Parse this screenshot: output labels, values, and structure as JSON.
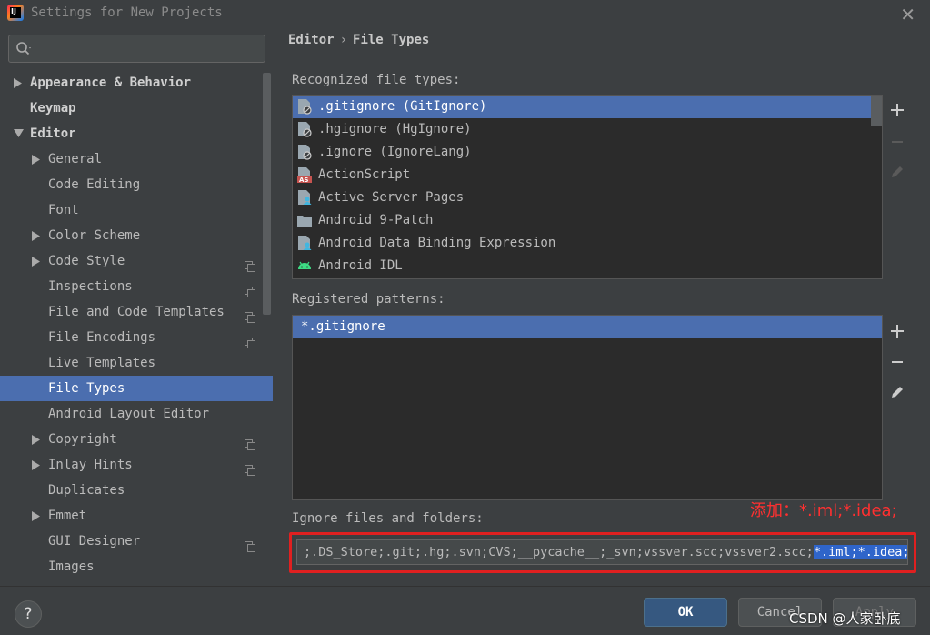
{
  "window": {
    "title": "Settings for New Projects",
    "logo_letter": "IJ"
  },
  "sidebar": {
    "search_placeholder": "",
    "items": [
      {
        "label": "Appearance & Behavior",
        "level": 0,
        "arrow": "right",
        "bold": true,
        "copy": false
      },
      {
        "label": "Keymap",
        "level": 0,
        "arrow": "",
        "bold": true,
        "copy": false
      },
      {
        "label": "Editor",
        "level": 0,
        "arrow": "down",
        "bold": true,
        "copy": false
      },
      {
        "label": "General",
        "level": 1,
        "arrow": "right",
        "bold": false,
        "copy": false
      },
      {
        "label": "Code Editing",
        "level": 1,
        "arrow": "",
        "bold": false,
        "copy": false
      },
      {
        "label": "Font",
        "level": 1,
        "arrow": "",
        "bold": false,
        "copy": false
      },
      {
        "label": "Color Scheme",
        "level": 1,
        "arrow": "right",
        "bold": false,
        "copy": false
      },
      {
        "label": "Code Style",
        "level": 1,
        "arrow": "right",
        "bold": false,
        "copy": true
      },
      {
        "label": "Inspections",
        "level": 1,
        "arrow": "",
        "bold": false,
        "copy": true
      },
      {
        "label": "File and Code Templates",
        "level": 1,
        "arrow": "",
        "bold": false,
        "copy": true
      },
      {
        "label": "File Encodings",
        "level": 1,
        "arrow": "",
        "bold": false,
        "copy": true
      },
      {
        "label": "Live Templates",
        "level": 1,
        "arrow": "",
        "bold": false,
        "copy": false
      },
      {
        "label": "File Types",
        "level": 1,
        "arrow": "",
        "bold": false,
        "copy": false,
        "selected": true
      },
      {
        "label": "Android Layout Editor",
        "level": 1,
        "arrow": "",
        "bold": false,
        "copy": false
      },
      {
        "label": "Copyright",
        "level": 1,
        "arrow": "right",
        "bold": false,
        "copy": true
      },
      {
        "label": "Inlay Hints",
        "level": 1,
        "arrow": "right",
        "bold": false,
        "copy": true
      },
      {
        "label": "Duplicates",
        "level": 1,
        "arrow": "",
        "bold": false,
        "copy": false
      },
      {
        "label": "Emmet",
        "level": 1,
        "arrow": "right",
        "bold": false,
        "copy": false
      },
      {
        "label": "GUI Designer",
        "level": 1,
        "arrow": "",
        "bold": false,
        "copy": true
      },
      {
        "label": "Images",
        "level": 1,
        "arrow": "",
        "bold": false,
        "copy": false
      }
    ]
  },
  "breadcrumb": {
    "parent": "Editor",
    "separator": "›",
    "current": "File Types"
  },
  "recognized": {
    "label": "Recognized file types:",
    "items": [
      {
        "label": ".gitignore (GitIgnore)",
        "icon": "ignore-file-icon",
        "selected": true
      },
      {
        "label": ".hgignore (HgIgnore)",
        "icon": "ignore-file-icon"
      },
      {
        "label": ".ignore (IgnoreLang)",
        "icon": "ignore-file-icon"
      },
      {
        "label": "ActionScript",
        "icon": "actionscript-icon",
        "badge": "AS"
      },
      {
        "label": "Active Server Pages",
        "icon": "asp-file-icon"
      },
      {
        "label": "Android 9-Patch",
        "icon": "folder-icon"
      },
      {
        "label": "Android Data Binding Expression",
        "icon": "asp-file-icon"
      },
      {
        "label": "Android IDL",
        "icon": "android-icon"
      }
    ]
  },
  "patterns": {
    "label": "Registered patterns:",
    "items": [
      "*.gitignore"
    ]
  },
  "ignore": {
    "label": "Ignore files and folders:",
    "value_plain": ";.DS_Store;.git;.hg;.svn;CVS;__pycache__;_svn;vssver.scc;vssver2.scc;",
    "value_selected": "*.iml;*.idea;",
    "annotation": "添加：*.iml;*.idea;"
  },
  "buttons": {
    "help": "?",
    "ok": "OK",
    "cancel": "Cancel",
    "apply": "Apply"
  },
  "watermark": "CSDN @人家卧底",
  "colors": {
    "selection": "#4b6eaf",
    "annotation": "#ff3030",
    "background": "#3c3f41"
  }
}
